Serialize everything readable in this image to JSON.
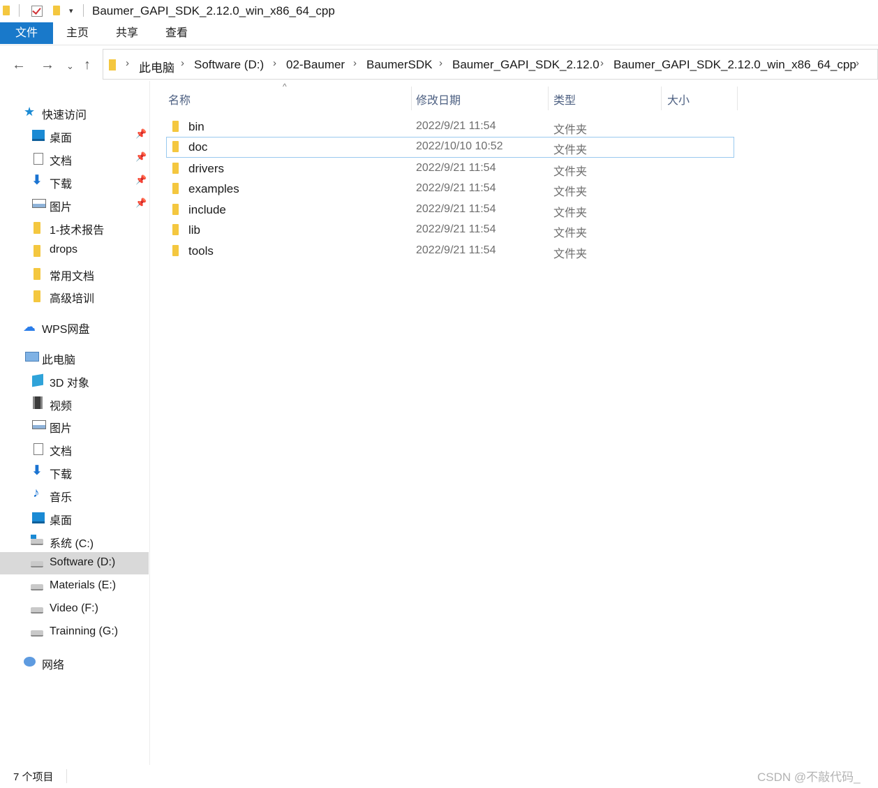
{
  "window": {
    "title": "Baumer_GAPI_SDK_2.12.0_win_x86_64_cpp"
  },
  "ribbon": {
    "tabs": [
      "文件",
      "主页",
      "共享",
      "查看"
    ]
  },
  "address": {
    "crumbs": [
      "此电脑",
      "Software (D:)",
      "02-Baumer",
      "BaumerSDK",
      "Baumer_GAPI_SDK_2.12.0",
      "Baumer_GAPI_SDK_2.12.0_win_x86_64_cpp"
    ]
  },
  "nav": {
    "quick_access": "快速访问",
    "quick_items": [
      "桌面",
      "文档",
      "下载",
      "图片",
      "1-技术报告",
      "drops",
      "常用文档",
      "高级培训"
    ],
    "wps": "WPS网盘",
    "this_pc": "此电脑",
    "pc_items": [
      "3D 对象",
      "视频",
      "图片",
      "文档",
      "下载",
      "音乐",
      "桌面",
      "系统 (C:)",
      "Software (D:)",
      "Materials (E:)",
      "Video (F:)",
      "Trainning (G:)"
    ],
    "network": "网络"
  },
  "columns": {
    "name": "名称",
    "date": "修改日期",
    "type": "类型",
    "size": "大小"
  },
  "files": [
    {
      "name": "bin",
      "date": "2022/9/21 11:54",
      "type": "文件夹"
    },
    {
      "name": "doc",
      "date": "2022/10/10 10:52",
      "type": "文件夹"
    },
    {
      "name": "drivers",
      "date": "2022/9/21 11:54",
      "type": "文件夹"
    },
    {
      "name": "examples",
      "date": "2022/9/21 11:54",
      "type": "文件夹"
    },
    {
      "name": "include",
      "date": "2022/9/21 11:54",
      "type": "文件夹"
    },
    {
      "name": "lib",
      "date": "2022/9/21 11:54",
      "type": "文件夹"
    },
    {
      "name": "tools",
      "date": "2022/9/21 11:54",
      "type": "文件夹"
    }
  ],
  "status": {
    "count": "7 个项目"
  },
  "watermark": "CSDN @不敲代码_",
  "colors": {
    "accent": "#1979ca",
    "folder": "#f4c73f",
    "selection": "#d9d9d9",
    "focus_border": "#99c9ef"
  }
}
